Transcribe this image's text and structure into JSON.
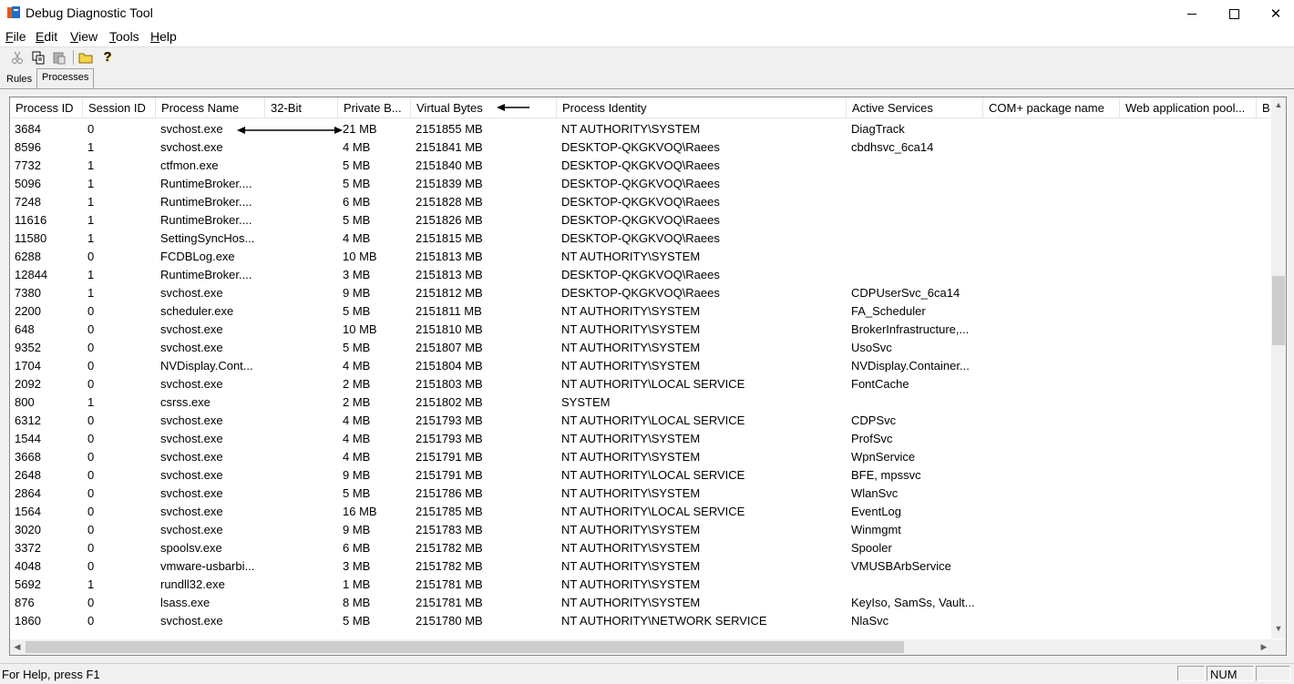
{
  "window": {
    "title": "Debug Diagnostic Tool",
    "close_glyph": "✕"
  },
  "menu": [
    "File",
    "Edit",
    "View",
    "Tools",
    "Help"
  ],
  "toolbar": {
    "icons": [
      "cut-icon",
      "copy-icon",
      "paste-icon",
      "open-folder-icon",
      "help-icon"
    ],
    "help_glyph": "?"
  },
  "tabs": [
    {
      "label": "Rules",
      "active": false
    },
    {
      "label": "Processes",
      "active": true
    }
  ],
  "columns": [
    "Process ID",
    "Session ID",
    "Process Name",
    "32-Bit",
    "Private B...",
    "Virtual Bytes",
    "Process Identity",
    "Active Services",
    "COM+ package name",
    "Web application pool...",
    "B"
  ],
  "rows": [
    [
      "3684",
      "0",
      "svchost.exe",
      "",
      "21 MB",
      "2151855 MB",
      "NT AUTHORITY\\SYSTEM",
      "DiagTrack"
    ],
    [
      "8596",
      "1",
      "svchost.exe",
      "",
      "4 MB",
      "2151841 MB",
      "DESKTOP-QKGKVOQ\\Raees",
      "cbdhsvc_6ca14"
    ],
    [
      "7732",
      "1",
      "ctfmon.exe",
      "",
      "5 MB",
      "2151840 MB",
      "DESKTOP-QKGKVOQ\\Raees",
      ""
    ],
    [
      "5096",
      "1",
      "RuntimeBroker....",
      "",
      "5 MB",
      "2151839 MB",
      "DESKTOP-QKGKVOQ\\Raees",
      ""
    ],
    [
      "7248",
      "1",
      "RuntimeBroker....",
      "",
      "6 MB",
      "2151828 MB",
      "DESKTOP-QKGKVOQ\\Raees",
      ""
    ],
    [
      "11616",
      "1",
      "RuntimeBroker....",
      "",
      "5 MB",
      "2151826 MB",
      "DESKTOP-QKGKVOQ\\Raees",
      ""
    ],
    [
      "11580",
      "1",
      "SettingSyncHos...",
      "",
      "4 MB",
      "2151815 MB",
      "DESKTOP-QKGKVOQ\\Raees",
      ""
    ],
    [
      "6288",
      "0",
      "FCDBLog.exe",
      "",
      "10 MB",
      "2151813 MB",
      "NT AUTHORITY\\SYSTEM",
      ""
    ],
    [
      "12844",
      "1",
      "RuntimeBroker....",
      "",
      "3 MB",
      "2151813 MB",
      "DESKTOP-QKGKVOQ\\Raees",
      ""
    ],
    [
      "7380",
      "1",
      "svchost.exe",
      "",
      "9 MB",
      "2151812 MB",
      "DESKTOP-QKGKVOQ\\Raees",
      "CDPUserSvc_6ca14"
    ],
    [
      "2200",
      "0",
      "scheduler.exe",
      "",
      "5 MB",
      "2151811 MB",
      "NT AUTHORITY\\SYSTEM",
      "FA_Scheduler"
    ],
    [
      "648",
      "0",
      "svchost.exe",
      "",
      "10 MB",
      "2151810 MB",
      "NT AUTHORITY\\SYSTEM",
      "BrokerInfrastructure,..."
    ],
    [
      "9352",
      "0",
      "svchost.exe",
      "",
      "5 MB",
      "2151807 MB",
      "NT AUTHORITY\\SYSTEM",
      "UsoSvc"
    ],
    [
      "1704",
      "0",
      "NVDisplay.Cont...",
      "",
      "4 MB",
      "2151804 MB",
      "NT AUTHORITY\\SYSTEM",
      "NVDisplay.Container..."
    ],
    [
      "2092",
      "0",
      "svchost.exe",
      "",
      "2 MB",
      "2151803 MB",
      "NT AUTHORITY\\LOCAL SERVICE",
      "FontCache"
    ],
    [
      "800",
      "1",
      "csrss.exe",
      "",
      "2 MB",
      "2151802 MB",
      "SYSTEM",
      ""
    ],
    [
      "6312",
      "0",
      "svchost.exe",
      "",
      "4 MB",
      "2151793 MB",
      "NT AUTHORITY\\LOCAL SERVICE",
      "CDPSvc"
    ],
    [
      "1544",
      "0",
      "svchost.exe",
      "",
      "4 MB",
      "2151793 MB",
      "NT AUTHORITY\\SYSTEM",
      "ProfSvc"
    ],
    [
      "3668",
      "0",
      "svchost.exe",
      "",
      "4 MB",
      "2151791 MB",
      "NT AUTHORITY\\SYSTEM",
      "WpnService"
    ],
    [
      "2648",
      "0",
      "svchost.exe",
      "",
      "9 MB",
      "2151791 MB",
      "NT AUTHORITY\\LOCAL SERVICE",
      "BFE, mpssvc"
    ],
    [
      "2864",
      "0",
      "svchost.exe",
      "",
      "5 MB",
      "2151786 MB",
      "NT AUTHORITY\\SYSTEM",
      "WlanSvc"
    ],
    [
      "1564",
      "0",
      "svchost.exe",
      "",
      "16 MB",
      "2151785 MB",
      "NT AUTHORITY\\LOCAL SERVICE",
      "EventLog"
    ],
    [
      "3020",
      "0",
      "svchost.exe",
      "",
      "9 MB",
      "2151783 MB",
      "NT AUTHORITY\\SYSTEM",
      "Winmgmt"
    ],
    [
      "3372",
      "0",
      "spoolsv.exe",
      "",
      "6 MB",
      "2151782 MB",
      "NT AUTHORITY\\SYSTEM",
      "Spooler"
    ],
    [
      "4048",
      "0",
      "vmware-usbarbi...",
      "",
      "3 MB",
      "2151782 MB",
      "NT AUTHORITY\\SYSTEM",
      "VMUSBArbService"
    ],
    [
      "5692",
      "1",
      "rundll32.exe",
      "",
      "1 MB",
      "2151781 MB",
      "NT AUTHORITY\\SYSTEM",
      ""
    ],
    [
      "876",
      "0",
      "lsass.exe",
      "",
      "8 MB",
      "2151781 MB",
      "NT AUTHORITY\\SYSTEM",
      "KeyIso, SamSs, Vault..."
    ],
    [
      "1860",
      "0",
      "svchost.exe",
      "",
      "5 MB",
      "2151780 MB",
      "NT AUTHORITY\\NETWORK SERVICE",
      "NlaSvc"
    ]
  ],
  "scroll_glyphs": {
    "up": "▲",
    "down": "▼",
    "left": "◀",
    "right": "▶"
  },
  "status": {
    "help_text": "For Help, press F1",
    "num": "NUM"
  }
}
